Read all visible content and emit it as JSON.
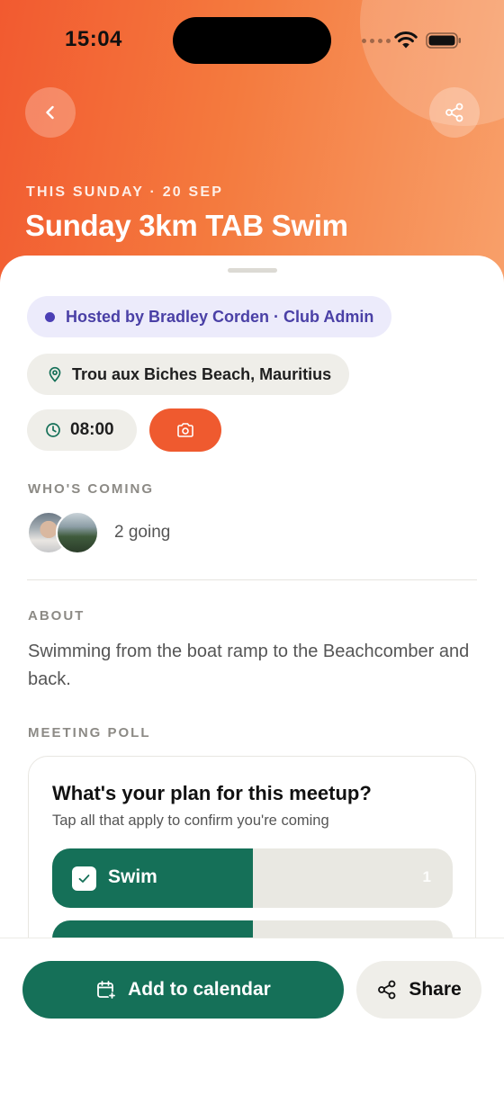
{
  "status_bar": {
    "time": "15:04"
  },
  "header": {
    "date_line": "THIS SUNDAY · 20 SEP",
    "title": "Sunday 3km TAB Swim"
  },
  "event": {
    "host": "Hosted by Bradley Corden · Club Admin",
    "location": "Trou aux Biches Beach, Mauritius",
    "time": "08:00"
  },
  "attendees": {
    "section_label": "WHO'S COMING",
    "going": "2 going"
  },
  "about": {
    "section_label": "ABOUT",
    "text": "Swimming from the boat ramp to the Beachcomber and back."
  },
  "poll": {
    "section_label": "MEETING POLL",
    "question": "What's your plan for this meetup?",
    "hint": "Tap all that apply to confirm you're coming",
    "options": [
      {
        "label": "Swim",
        "count": "1",
        "checked": true,
        "share": 0.5
      },
      {
        "label": "",
        "count": "",
        "checked": false,
        "share": 0.5
      }
    ]
  },
  "actions": {
    "calendar": "Add to calendar",
    "share": "Share"
  },
  "colors": {
    "accent_orange": "#ef5a2f",
    "brand_green": "#157058",
    "host_purple": "#4b3fb5"
  },
  "icons": [
    "back-arrow-icon",
    "share-icon",
    "location-pin-icon",
    "clock-icon",
    "camera-icon",
    "check-icon",
    "calendar-plus-icon",
    "wifi-icon",
    "battery-icon"
  ]
}
